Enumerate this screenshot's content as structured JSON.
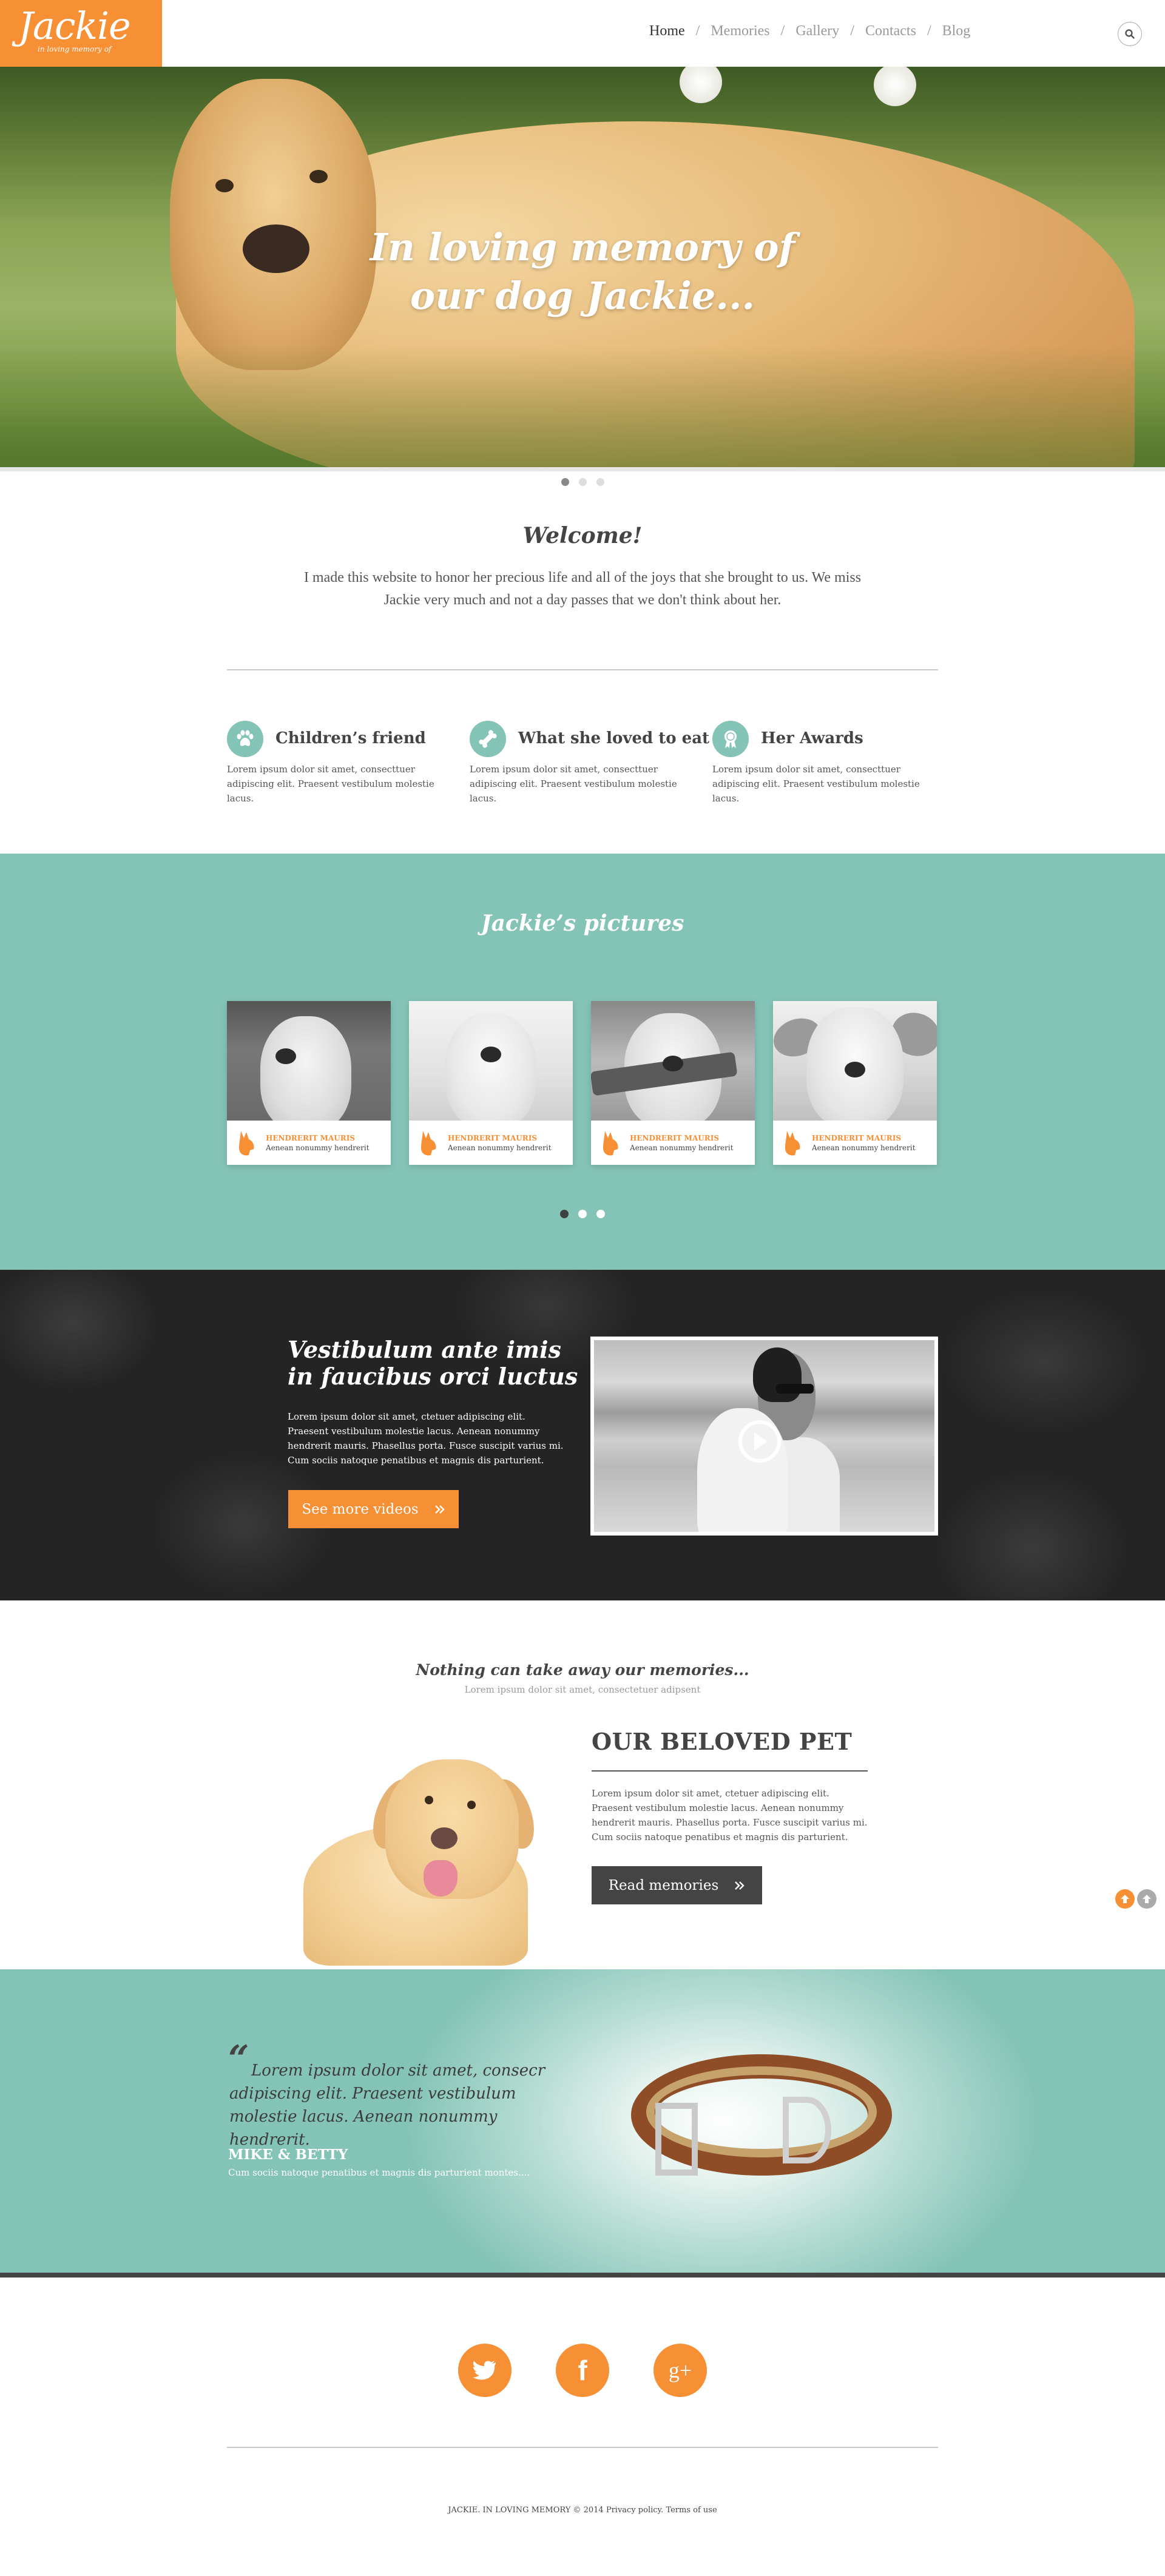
{
  "header": {
    "logo_name": "Jackie",
    "logo_tagline": "in loving memory of",
    "nav": [
      {
        "label": "Home",
        "active": true
      },
      {
        "label": "Memories",
        "active": false
      },
      {
        "label": "Gallery",
        "active": false
      },
      {
        "label": "Contacts",
        "active": false
      },
      {
        "label": "Blog",
        "active": false
      }
    ],
    "nav_separator": "/",
    "search_icon": "search-icon"
  },
  "hero": {
    "title_line1": "In loving memory of",
    "title_line2": "our dog Jackie...",
    "slider_dots": 3,
    "active_dot": 1
  },
  "welcome": {
    "title": "Welcome!",
    "text": "I made this website to honor her precious life and all of the joys that she brought to us. We miss Jackie very much and not a day passes that we don't think about her."
  },
  "features": [
    {
      "icon": "paw-icon",
      "title": "Children’s friend",
      "text": "Lorem ipsum dolor sit amet, consecttuer adipiscing elit. Praesent vestibulum molestie lacus."
    },
    {
      "icon": "bone-icon",
      "title": "What she loved to eat",
      "text": "Lorem ipsum dolor sit amet, consecttuer adipiscing elit. Praesent vestibulum molestie lacus."
    },
    {
      "icon": "award-ribbon-icon",
      "title": "Her Awards",
      "text": "Lorem ipsum dolor sit amet, consecttuer adipiscing elit. Praesent vestibulum molestie lacus."
    }
  ],
  "pictures": {
    "title": "Jackie’s pictures",
    "cards": [
      {
        "caption_title": "HENDRERIT MAURIS",
        "caption_sub": "Aenean nonummy hendrerit"
      },
      {
        "caption_title": "HENDRERIT MAURIS",
        "caption_sub": "Aenean nonummy hendrerit"
      },
      {
        "caption_title": "HENDRERIT MAURIS",
        "caption_sub": "Aenean nonummy hendrerit"
      },
      {
        "caption_title": "HENDRERIT MAURIS",
        "caption_sub": "Aenean nonummy hendrerit"
      }
    ],
    "slider_dots": 3,
    "active_dot": 1
  },
  "video": {
    "title": "Vestibulum ante imis in faucibus orci luctus",
    "text": "Lorem ipsum dolor sit amet, ctetuer adipiscing elit. Praesent vestibulum molestie lacus. Aenean nonummy hendrerit mauris. Phasellus porta. Fusce suscipit varius mi. Cum sociis natoque penatibus et magnis dis parturient.",
    "button_label": "See more videos",
    "button_icon": "double-chevron-right-icon",
    "play_icon": "play-icon"
  },
  "memories": {
    "title": "Nothing can take away our memories...",
    "subtitle": "Lorem ipsum dolor sit amet, consectetuer adipsent",
    "pet_title": "OUR BELOVED PET",
    "pet_text": "Lorem ipsum dolor sit amet, ctetuer adipiscing elit. Praesent vestibulum molestie lacus. Aenean nonummy hendrerit mauris. Phasellus porta. Fusce suscipit varius mi. Cum sociis natoque penatibus et magnis dis parturient.",
    "button_label": "Read memories"
  },
  "testimonial": {
    "quote_mark": "“",
    "quote": "Lorem ipsum dolor sit amet, consecr adipiscing elit. Praesent vestibulum molestie lacus. Aenean nonummy hendrerit.",
    "author": "MIKE & BETTY",
    "author_sub": "Cum sociis natoque penatibus et magnis dis parturient montes...."
  },
  "footer": {
    "social": [
      {
        "name": "twitter",
        "glyph": ""
      },
      {
        "name": "facebook",
        "glyph": "f"
      },
      {
        "name": "google-plus",
        "glyph": "g+"
      }
    ],
    "copyright": "JACKIE. IN LOVING MEMORY © 2014",
    "privacy": "Privacy policy.",
    "terms": "Terms of use"
  },
  "colors": {
    "accent_orange": "#f78f34",
    "teal": "#84c4b6",
    "dark": "#444444"
  }
}
